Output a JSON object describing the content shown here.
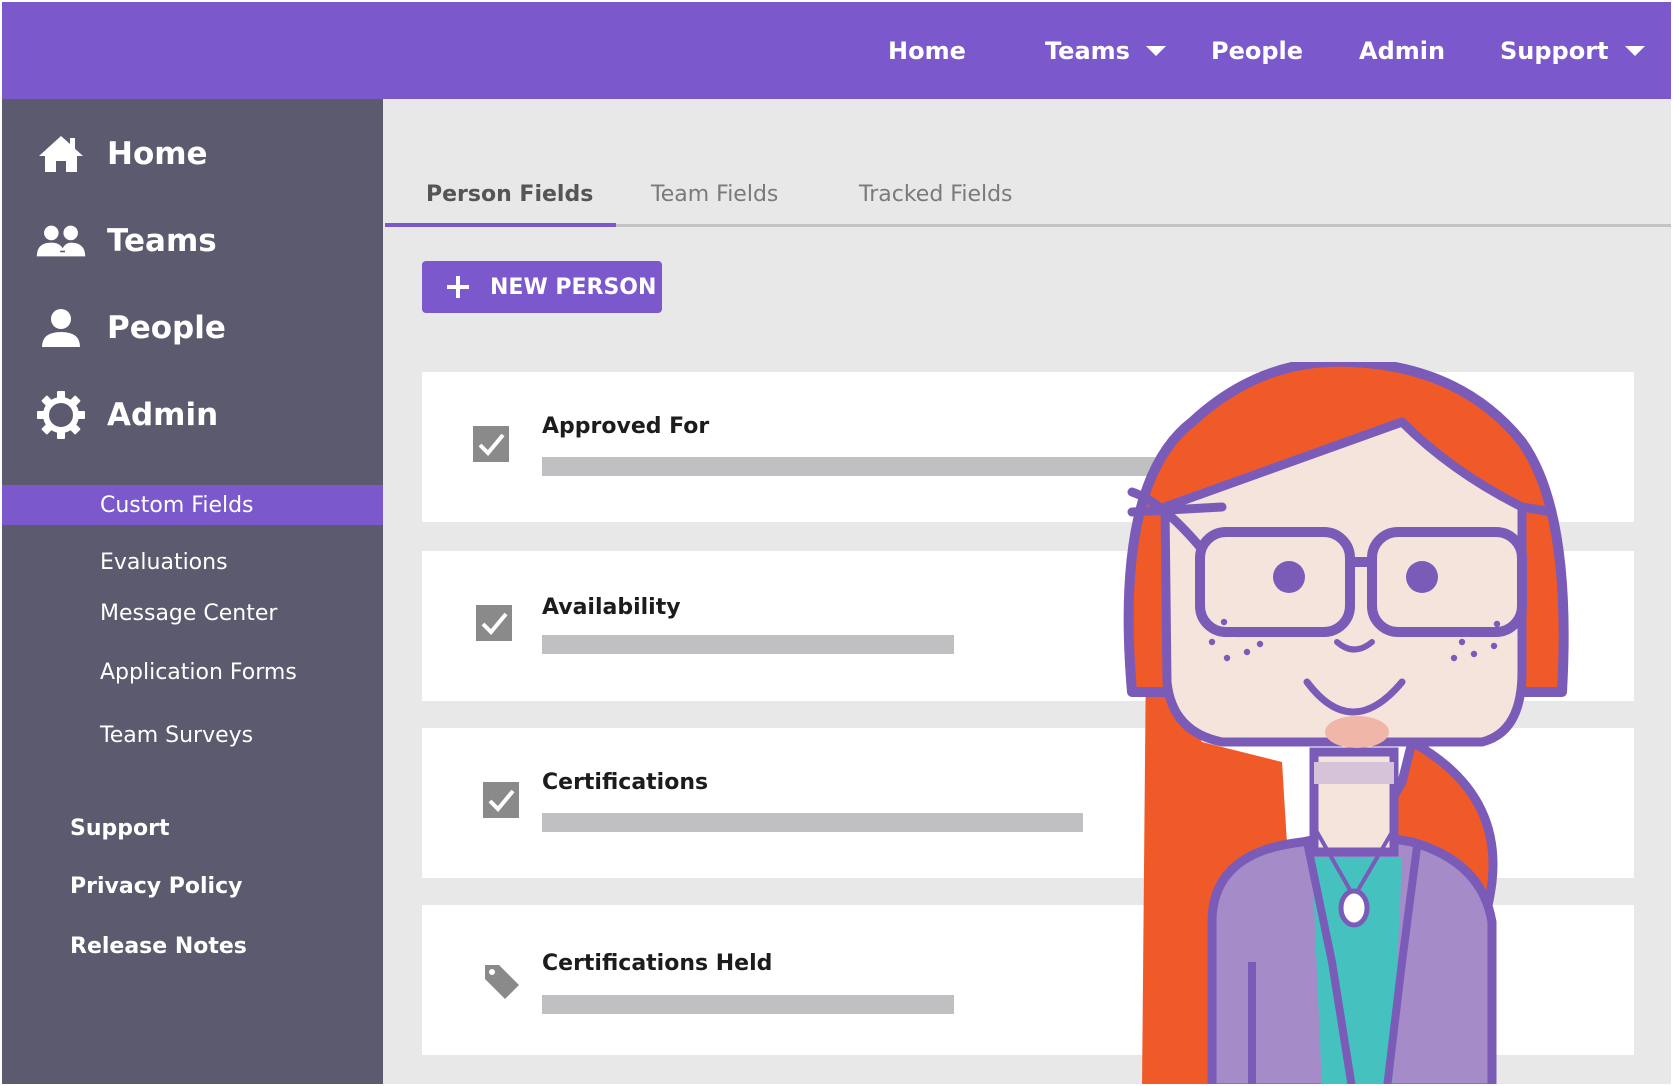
{
  "topnav": {
    "items": [
      {
        "label": "Home"
      },
      {
        "label": "Teams"
      },
      {
        "label": "People"
      },
      {
        "label": "Admin"
      },
      {
        "label": "Support"
      }
    ]
  },
  "sidebar": {
    "main": [
      {
        "label": "Home",
        "icon": "home-icon"
      },
      {
        "label": "Teams",
        "icon": "teams-icon"
      },
      {
        "label": "People",
        "icon": "person-icon"
      },
      {
        "label": "Admin",
        "icon": "gear-icon"
      }
    ],
    "admin_sub": [
      {
        "label": "Custom Fields",
        "active": true
      },
      {
        "label": "Evaluations"
      },
      {
        "label": "Message Center"
      },
      {
        "label": "Application Forms"
      },
      {
        "label": "Team Surveys"
      }
    ],
    "footer": [
      {
        "label": "Support"
      },
      {
        "label": "Privacy Policy"
      },
      {
        "label": "Release Notes"
      }
    ]
  },
  "tabs": [
    {
      "label": "Person Fields",
      "active": true
    },
    {
      "label": "Team Fields"
    },
    {
      "label": "Tracked Fields"
    }
  ],
  "new_button": {
    "label": "NEW PERSON",
    "icon": "plus-icon"
  },
  "fields": [
    {
      "title": "Approved For",
      "icon": "checkbox-checked-icon"
    },
    {
      "title": "Availability",
      "icon": "checkbox-checked-icon"
    },
    {
      "title": "Certifications",
      "icon": "checkbox-checked-icon"
    },
    {
      "title": "Certifications Held",
      "icon": "tag-icon"
    }
  ],
  "colors": {
    "brand": "#7b59cd",
    "sidebar": "#5b5a6e",
    "hair": "#f05a28",
    "outline": "#7a5bb7"
  }
}
